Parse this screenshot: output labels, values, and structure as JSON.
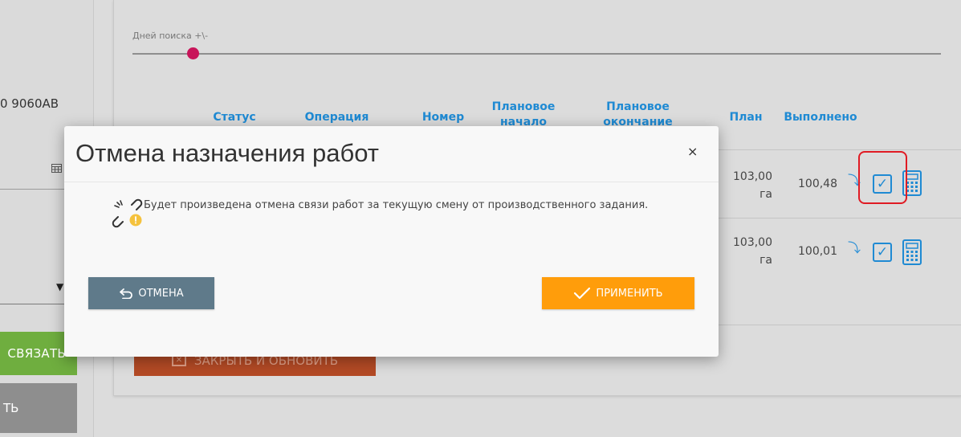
{
  "left_panel": {
    "code": "0 9060AB",
    "green_button_label": "СВЯЗАТЬ",
    "grey_button_label": "ТЬ"
  },
  "search": {
    "days_label": "Дней поиска +\\-",
    "days_value": 2
  },
  "table": {
    "headers": {
      "status": "Статус",
      "operation": "Операция",
      "number": "Номер",
      "planned_start": "Плановое начало",
      "planned_end": "Плановое окончание",
      "plan": "План",
      "done": "Выполнено"
    },
    "rows": [
      {
        "plan": "103,00",
        "plan_unit": "га",
        "done": "100,48"
      },
      {
        "plan": "103,00",
        "plan_unit": "га",
        "done": "100,01"
      }
    ]
  },
  "close_refresh_label": "ЗАКРЫТЬ И ОБНОВИТЬ",
  "modal": {
    "title": "Отмена назначения работ",
    "close_symbol": "×",
    "message": "Будет произведена отмена связи работ за текущую смену от производственного задания.",
    "cancel_label": "ОТМЕНА",
    "apply_label": "ПРИМЕНИТЬ"
  },
  "colors": {
    "header_blue": "#1f8ad3",
    "slider_knob": "#c8155a",
    "apply_orange": "#ff9d0b",
    "cancel_slate": "#5f7a8a",
    "highlight_red": "#e01b24"
  }
}
